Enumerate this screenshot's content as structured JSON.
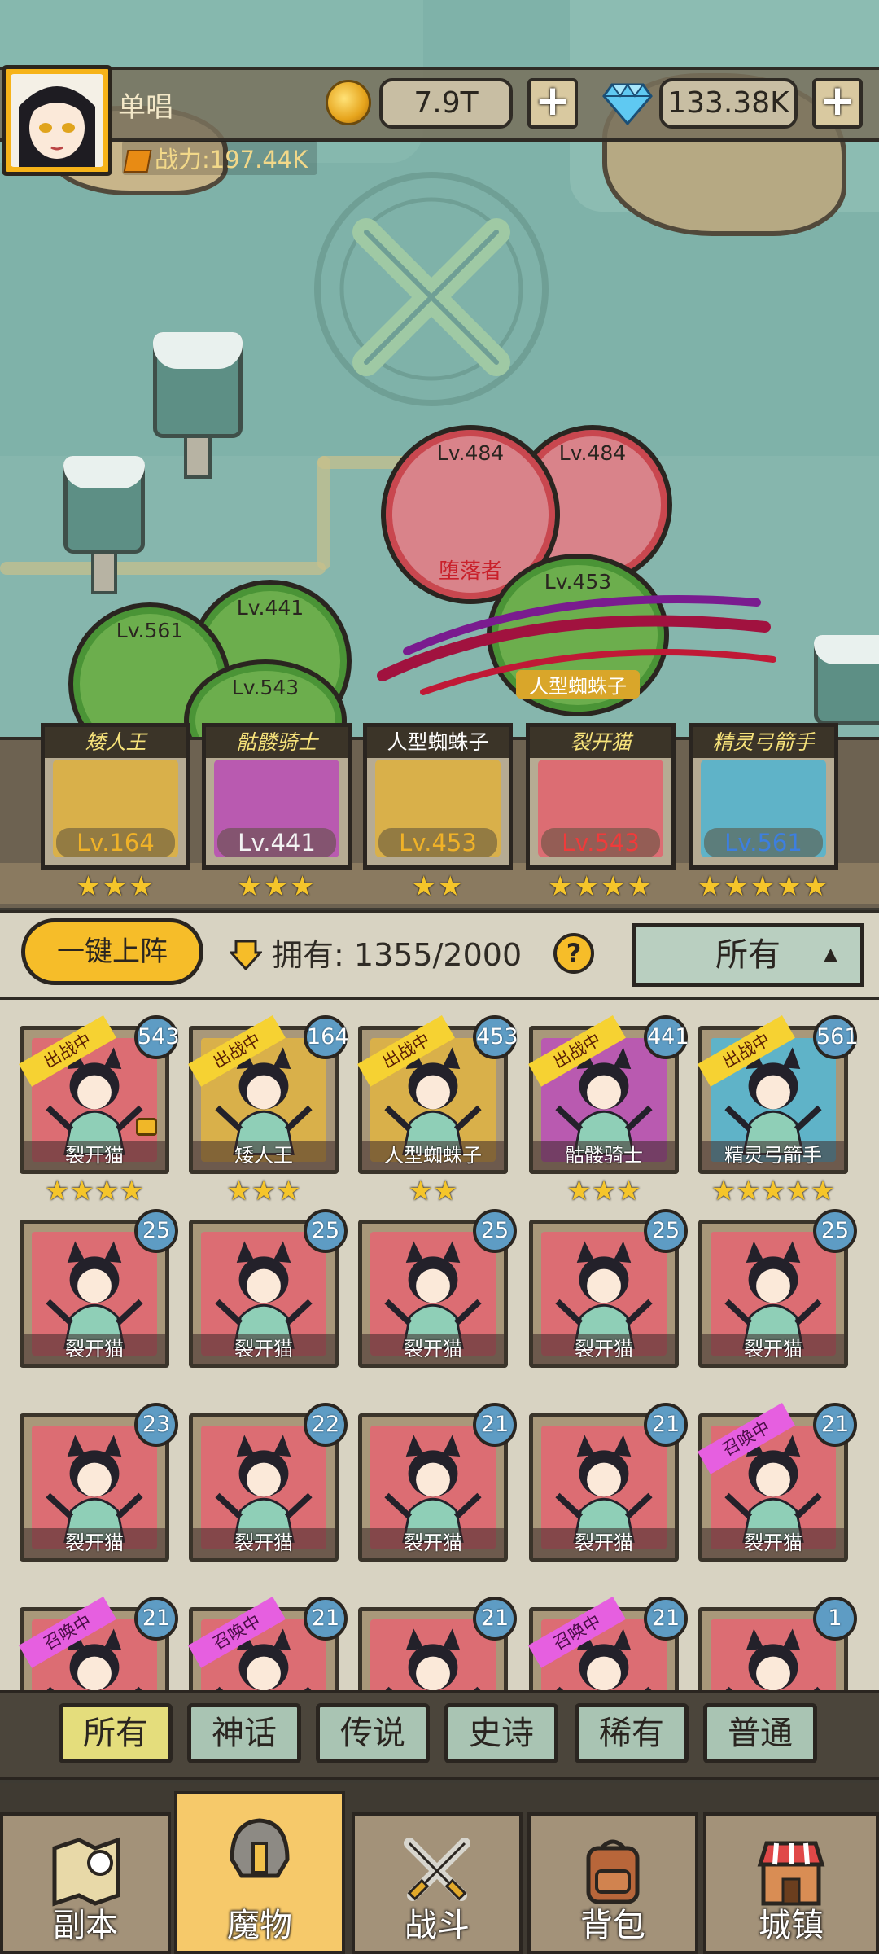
{
  "player": {
    "name": "单唱",
    "combat_power": "战力:197.44K"
  },
  "resources": {
    "coins": "7.9T",
    "gems": "133.38K"
  },
  "colors": {
    "accent_yellow": "#f6bd29",
    "panel": "#d8d3c2",
    "rarity_red": "#d9838a",
    "rarity_green": "#6cae4d",
    "level_badge": "#5e9cc4"
  },
  "map_tokens": [
    {
      "level": "Lv.484",
      "name": "堕落者"
    },
    {
      "level": "Lv.484",
      "name": ""
    },
    {
      "level": "Lv.453",
      "name": "人型蜘蛛子"
    },
    {
      "level": "Lv.441",
      "name": ""
    },
    {
      "level": "Lv.561",
      "name": ""
    },
    {
      "level": "Lv.543",
      "name": ""
    }
  ],
  "team": [
    {
      "name": "矮人王",
      "level": "Lv.164",
      "stars": "★★★",
      "bg": "#d9b04a"
    },
    {
      "name": "骷髅骑士",
      "level": "Lv.441",
      "stars": "★★★",
      "bg": "#b95ab0"
    },
    {
      "name": "人型蜘蛛子",
      "level": "Lv.453",
      "stars": "★★",
      "bg": "#d9b04a"
    },
    {
      "name": "裂开猫",
      "level": "Lv.543",
      "stars": "★★★★",
      "bg": "#dc6d73"
    },
    {
      "name": "精灵弓箭手",
      "level": "Lv.561",
      "stars": "★★★★★",
      "bg": "#5fb3c8"
    }
  ],
  "controls": {
    "deploy_label": "一键上阵",
    "own_label": "拥有:",
    "own_count": "1355/2000",
    "help": "?",
    "filter_value": "所有",
    "filter_arrow": "▲"
  },
  "roster_rows": [
    [
      {
        "name": "裂开猫",
        "level": "543",
        "tag": "出战中",
        "stars": "★★★★",
        "bg": "#dc6d73",
        "locked": true
      },
      {
        "name": "矮人王",
        "level": "164",
        "tag": "出战中",
        "stars": "★★★",
        "bg": "#d9b04a"
      },
      {
        "name": "人型蜘蛛子",
        "level": "453",
        "tag": "出战中",
        "stars": "★★",
        "bg": "#d9b04a"
      },
      {
        "name": "骷髅骑士",
        "level": "441",
        "tag": "出战中",
        "stars": "★★★",
        "bg": "#b95ab0"
      },
      {
        "name": "精灵弓箭手",
        "level": "561",
        "tag": "出战中",
        "stars": "★★★★★",
        "bg": "#5fb3c8"
      }
    ],
    [
      {
        "name": "裂开猫",
        "level": "25",
        "tag": "",
        "bg": "#dc6d73"
      },
      {
        "name": "裂开猫",
        "level": "25",
        "tag": "",
        "bg": "#dc6d73"
      },
      {
        "name": "裂开猫",
        "level": "25",
        "tag": "",
        "bg": "#dc6d73"
      },
      {
        "name": "裂开猫",
        "level": "25",
        "tag": "",
        "bg": "#dc6d73"
      },
      {
        "name": "裂开猫",
        "level": "25",
        "tag": "",
        "bg": "#dc6d73"
      }
    ],
    [
      {
        "name": "裂开猫",
        "level": "23",
        "tag": "",
        "bg": "#dc6d73"
      },
      {
        "name": "裂开猫",
        "level": "22",
        "tag": "",
        "bg": "#dc6d73"
      },
      {
        "name": "裂开猫",
        "level": "21",
        "tag": "",
        "bg": "#dc6d73"
      },
      {
        "name": "裂开猫",
        "level": "21",
        "tag": "",
        "bg": "#dc6d73"
      },
      {
        "name": "裂开猫",
        "level": "21",
        "tag": "召唤中",
        "bg": "#dc6d73"
      }
    ],
    [
      {
        "name": "",
        "level": "21",
        "tag": "召唤中",
        "bg": "#dc6d73"
      },
      {
        "name": "",
        "level": "21",
        "tag": "召唤中",
        "bg": "#dc6d73"
      },
      {
        "name": "",
        "level": "21",
        "tag": "",
        "bg": "#dc6d73"
      },
      {
        "name": "",
        "level": "21",
        "tag": "召唤中",
        "bg": "#dc6d73"
      },
      {
        "name": "",
        "level": "1",
        "tag": "",
        "bg": "#dc6d73"
      }
    ]
  ],
  "rarity_tabs": [
    "所有",
    "神话",
    "传说",
    "史诗",
    "稀有",
    "普通"
  ],
  "bottom_nav": [
    {
      "label": "副本",
      "icon": "map-icon"
    },
    {
      "label": "魔物",
      "icon": "helmet-icon"
    },
    {
      "label": "战斗",
      "icon": "crossed-swords-icon"
    },
    {
      "label": "背包",
      "icon": "backpack-icon"
    },
    {
      "label": "城镇",
      "icon": "shop-icon"
    }
  ]
}
